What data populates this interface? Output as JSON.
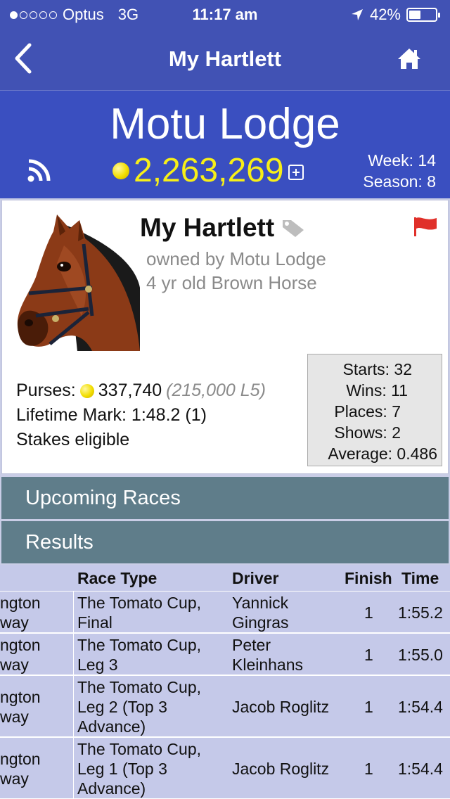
{
  "status_bar": {
    "carrier": "Optus",
    "network": "3G",
    "time": "11:17 am",
    "battery": "42%",
    "signal_bars": 1
  },
  "nav": {
    "title": "My Hartlett",
    "back_icon": "chevron-left-icon",
    "home_icon": "home-icon"
  },
  "header": {
    "stable_name": "Motu Lodge",
    "balance": "2,263,269",
    "week": "Week: 14",
    "season": "Season: 8"
  },
  "horse": {
    "name": "My Hartlett",
    "owner": "owned by Motu Lodge",
    "description": "4 yr old Brown Horse",
    "purses_label": "Purses:",
    "purses_value": "337,740",
    "purses_l5": "(215,000 L5)",
    "lifetime_mark": "Lifetime Mark: 1:48.2 (1)",
    "stakes": "Stakes eligible",
    "flag_color": "#e0302a"
  },
  "stats": {
    "starts": "Starts: 32",
    "wins": "Wins: 11",
    "places": "Places: 7",
    "shows": "Shows: 2",
    "average": "Average: 0.486"
  },
  "sections": {
    "upcoming": "Upcoming Races",
    "results": "Results"
  },
  "results_table": {
    "headers": {
      "race_type": "Race Type",
      "driver": "Driver",
      "finish": "Finish",
      "time": "Time"
    },
    "rows": [
      {
        "track_l1": "ngton",
        "track_l2": "way",
        "type_l1": "The Tomato Cup,",
        "type_l2": "Final",
        "type_l3": "",
        "driver_l1": "Yannick",
        "driver_l2": "Gingras",
        "finish": "1",
        "time": "1:55.2"
      },
      {
        "track_l1": "ngton",
        "track_l2": "way",
        "type_l1": "The Tomato Cup,",
        "type_l2": "Leg 3",
        "type_l3": "",
        "driver_l1": "Peter",
        "driver_l2": "Kleinhans",
        "finish": "1",
        "time": "1:55.0"
      },
      {
        "track_l1": "ngton",
        "track_l2": "way",
        "type_l1": "The Tomato Cup,",
        "type_l2": "Leg 2 (Top 3",
        "type_l3": "Advance)",
        "driver_l1": "Jacob Roglitz",
        "driver_l2": "",
        "finish": "1",
        "time": "1:54.4"
      },
      {
        "track_l1": "ngton",
        "track_l2": "way",
        "type_l1": "The Tomato Cup,",
        "type_l2": "Leg 1 (Top 3",
        "type_l3": "Advance)",
        "driver_l1": "Jacob Roglitz",
        "driver_l2": "",
        "finish": "1",
        "time": "1:54.4"
      }
    ]
  }
}
